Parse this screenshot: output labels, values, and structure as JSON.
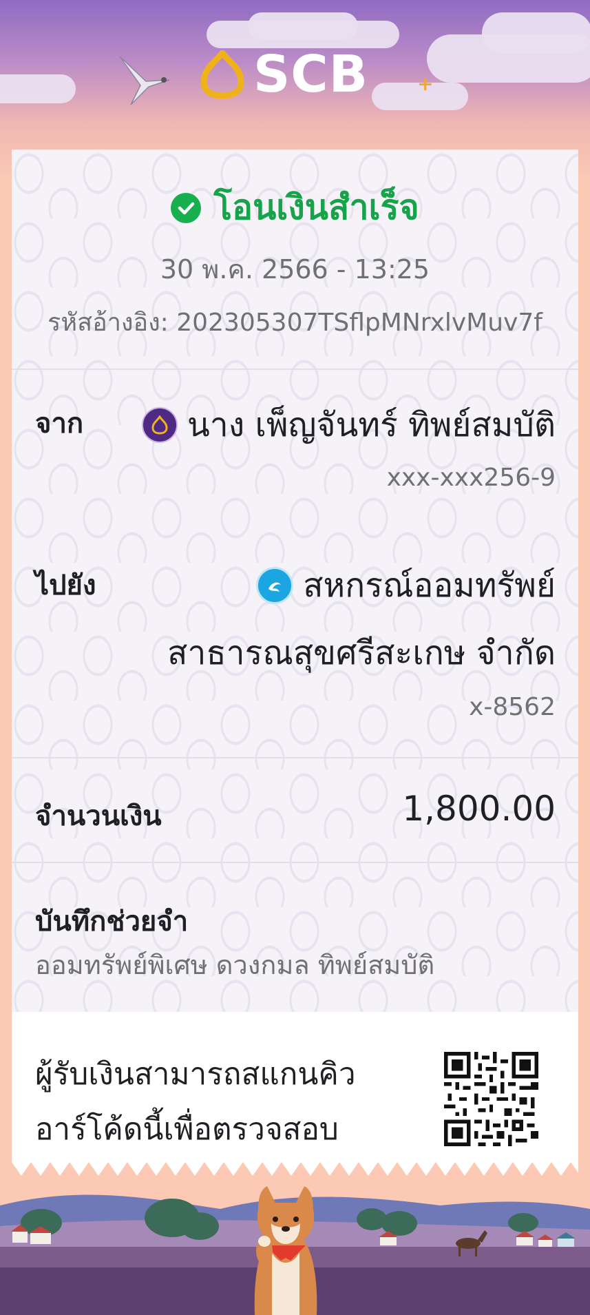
{
  "brand": {
    "name": "SCB",
    "plus": "+"
  },
  "receipt": {
    "status_text": "โอนเงินสำเร็จ",
    "datetime": "30 พ.ค. 2566 - 13:25",
    "reference": "รหัสอ้างอิง: 202305307TSflpMNrxlvMuv7f",
    "from": {
      "label": "จาก",
      "name": "นาง เพ็ญจันทร์ ทิพย์สมบัติ",
      "account": "xxx-xxx256-9"
    },
    "to": {
      "label": "ไปยัง",
      "name_line1": "สหกรณ์ออมทรัพย์",
      "name_line2": "สาธารณสุขศรีสะเกษ จำกัด",
      "account": "x-8562"
    },
    "amount": {
      "label": "จำนวนเงิน",
      "value": "1,800.00"
    },
    "memo": {
      "label": "บันทึกช่วยจำ",
      "text": "ออมทรัพย์พิเศษ ดวงกมล ทิพย์สมบัติ"
    },
    "verify": {
      "line1": "ผู้รับเงินสามารถสแกนคิว",
      "line2": "อาร์โค้ดนี้เพื่อตรวจสอบ"
    }
  },
  "colors": {
    "success": "#16a34a",
    "brand_purple": "#4e2a84",
    "card_bg": "#f5f3f8",
    "accent_peach": "#fbc9b4"
  },
  "icons": [
    "check-circle-icon",
    "scb-bank-icon",
    "ktb-bank-icon",
    "qr-code-icon",
    "scb-logo-icon"
  ]
}
